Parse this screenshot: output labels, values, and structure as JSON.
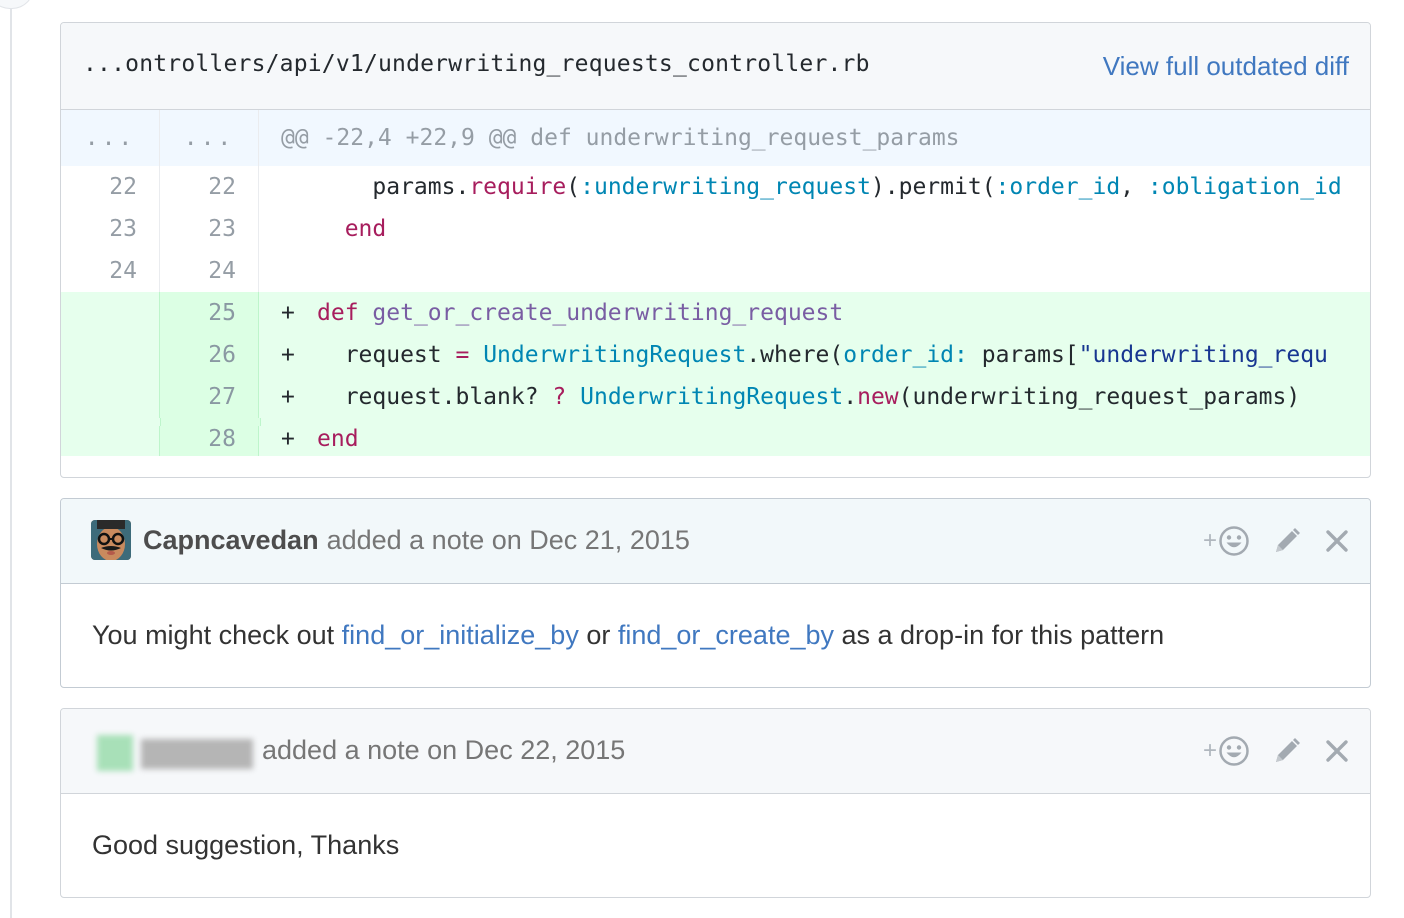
{
  "diff": {
    "file_path": "...ontrollers/api/v1/underwriting_requests_controller.rb",
    "view_full_label": "View full outdated diff",
    "hunk": {
      "old_num": "...",
      "new_num": "...",
      "text": "@@ -22,4 +22,9 @@ def underwriting_request_params"
    },
    "context_lines": [
      {
        "old": "22",
        "new": "22"
      },
      {
        "old": "23",
        "new": "23"
      },
      {
        "old": "24",
        "new": "24"
      }
    ],
    "added_lines": [
      {
        "new": "25",
        "marker": "+"
      },
      {
        "new": "26",
        "marker": "+"
      },
      {
        "new": "27",
        "marker": "+"
      },
      {
        "new": "28",
        "marker": "+"
      }
    ],
    "tokens": {
      "l22": {
        "a": "    params.",
        "b": "require",
        "c": "(",
        "d": ":underwriting_request",
        "e": ").permit(",
        "f": ":order_id",
        "g": ", ",
        "h": ":obligation_id"
      },
      "l23": {
        "a": "  ",
        "b": "end"
      },
      "l25": {
        "a": "def",
        "b": " ",
        "c": "get_or_create_underwriting_request"
      },
      "l26": {
        "a": "  request ",
        "b": "=",
        "c": " ",
        "d": "UnderwritingRequest",
        "e": ".where(",
        "f": "order_id:",
        "g": " params[",
        "h": "\"underwriting_requ"
      },
      "l27": {
        "a": "  request.blank? ",
        "b": "?",
        "c": " ",
        "d": "UnderwritingRequest",
        "e": ".",
        "f": "new",
        "g": "(underwriting_request_params)"
      },
      "l28": {
        "a": "end"
      }
    }
  },
  "comments": [
    {
      "author": "Capncavedan",
      "meta": "added a note on Dec 21, 2015",
      "body": {
        "before": "You might check out ",
        "link1": "find_or_initialize_by",
        "middle": " or ",
        "link2": "find_or_create_by",
        "after": " as a drop-in for this pattern"
      },
      "actions": {
        "react_plus": "+",
        "react_icon": "smiley-icon",
        "edit_icon": "pencil-icon",
        "close_icon": "x-icon"
      }
    },
    {
      "author": "",
      "meta": "added a note on Dec 22, 2015",
      "body": {
        "text": "Good suggestion, Thanks"
      },
      "actions": {
        "react_plus": "+",
        "react_icon": "smiley-icon",
        "edit_icon": "pencil-icon",
        "close_icon": "x-icon"
      }
    }
  ],
  "colors": {
    "link": "#4078c0",
    "keyword": "#a71d5d",
    "function": "#795da3",
    "symbol": "#0086b3",
    "string": "#183691",
    "added_bg": "#e6ffed",
    "hunk_bg": "#f1f8ff"
  }
}
